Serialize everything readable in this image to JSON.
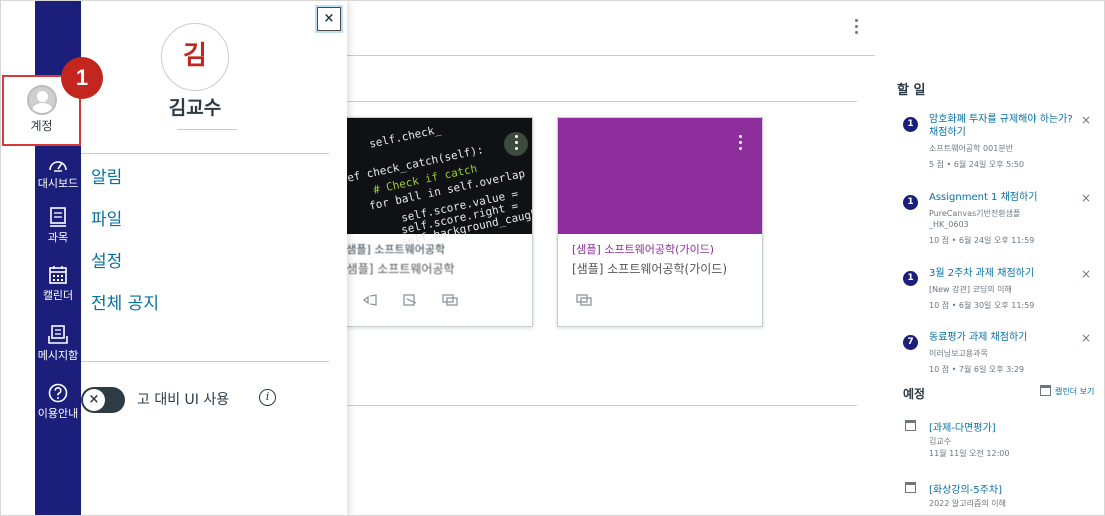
{
  "global_nav": {
    "account_label": "계정",
    "items": [
      {
        "label": "대시보드",
        "icon": "dashboard-icon"
      },
      {
        "label": "과목",
        "icon": "courses-icon"
      },
      {
        "label": "캘린더",
        "icon": "calendar-icon"
      },
      {
        "label": "메시지함",
        "icon": "inbox-icon"
      },
      {
        "label": "이용안내",
        "icon": "help-icon"
      }
    ],
    "colors": {
      "nav_bg": "#1b1f7a",
      "highlight": "#d63a3a"
    }
  },
  "annotation": {
    "step_number": "1",
    "color": "#c2261f"
  },
  "tray": {
    "close_glyph": "×",
    "avatar_initial": "김",
    "user_name": "김교수",
    "links": [
      "알림",
      "파일",
      "설정",
      "전체 공지"
    ],
    "toggle_glyph": "×",
    "toggle_label": "고 대비 UI 사용",
    "info_glyph": "i"
  },
  "cards": [
    {
      "title": "[샘플] 소프트웨어공학",
      "subtitle": "[샘플] 소프트웨어공학",
      "hero": "code-image",
      "code_lines": [
        "self.check_",
        "ef check_catch(self):",
        "# Check if catch",
        "for ball in self.overlap",
        "self.score.value =",
        "self.score.right =",
        "self.background_caught()"
      ]
    },
    {
      "title": "[샘플] 소프트웨어공학(가이드)",
      "subtitle": "[샘플] 소프트웨어공학(가이드)",
      "hero_color": "#8e2e9c"
    }
  ],
  "sidebar": {
    "todo_heading": "할 일",
    "todo_items": [
      {
        "badge": "1",
        "title": "암호화폐 투자를 규제해야 하는가? 채점하기",
        "course": "소프트웨어공학 001분반",
        "detail": "5 점 • 6월 24일 오후 5:50"
      },
      {
        "badge": "1",
        "title": "Assignment 1 채점하기",
        "course": "PureCanvas기반전환샘플",
        "course2": "_HK_0603",
        "detail": "10 점 • 6월 24일 오후 11:59"
      },
      {
        "badge": "1",
        "title": "3월 2주차 과제 채점하기",
        "course": "[New 강관] 코딩의 이해",
        "detail": "10 점 • 6월 30일 오후 11:59"
      },
      {
        "badge": "7",
        "title": "동료평가 과제 채점하기",
        "course": "이러닝보고용과목",
        "detail": "10 점 • 7월 6일 오후 3:29"
      }
    ],
    "dismiss_glyph": "×",
    "upcoming_heading": "예정",
    "calendar_link": "캘린더 보기",
    "upcoming_items": [
      {
        "title": "[과제-다면평가]",
        "meta1": "김교수",
        "meta2": "11월 11일 오전 12:00"
      },
      {
        "title": "[화상강의-5주차]",
        "meta1": "2022 알고리즘의 이해",
        "meta2": ""
      }
    ]
  }
}
